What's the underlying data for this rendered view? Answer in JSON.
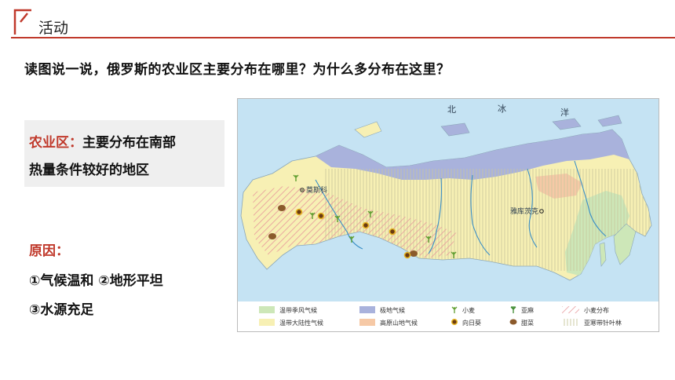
{
  "header": {
    "title": "活动",
    "accent_color": "#c0392b"
  },
  "question": "读图说一说，俄罗斯的农业区主要分布在哪里？为什么多分布在这里？",
  "answer": {
    "label": "农业区：",
    "line1_rest": "主要分布在南部",
    "line2": "热量条件较好的地区"
  },
  "reasons": {
    "title": "原因：",
    "line1": "①气候温和  ②地形平坦",
    "line2": "③水源充足"
  },
  "map": {
    "sea_label": [
      "北",
      "冰",
      "洋"
    ],
    "cities": {
      "moscow": "莫斯科",
      "yakutsk": "雅库茨克"
    },
    "colors": {
      "ocean": "#c5e3f3",
      "continental": "#f7f0b4",
      "monsoon": "#cde7b8",
      "polar": "#a9b2dc",
      "highland": "#f6c9a6",
      "wheat_hatch": "#e8999b",
      "taiga_hatch": "#c8c69c"
    },
    "legend": [
      {
        "icon": "swatch-temperate-monsoon",
        "label": "温带季风气候"
      },
      {
        "icon": "swatch-polar",
        "label": "极地气候"
      },
      {
        "icon": "wheat-icon",
        "label": "小麦"
      },
      {
        "icon": "flax-icon",
        "label": "亚麻"
      },
      {
        "icon": "hatch-wheat",
        "label": "小麦分布"
      },
      {
        "icon": "swatch-temperate-continental",
        "label": "温带大陆性气候"
      },
      {
        "icon": "swatch-highland",
        "label": "高原山地气候"
      },
      {
        "icon": "sunflower-icon",
        "label": "向日葵"
      },
      {
        "icon": "beet-icon",
        "label": "甜菜"
      },
      {
        "icon": "hatch-taiga",
        "label": "亚寒带针叶林"
      }
    ]
  }
}
